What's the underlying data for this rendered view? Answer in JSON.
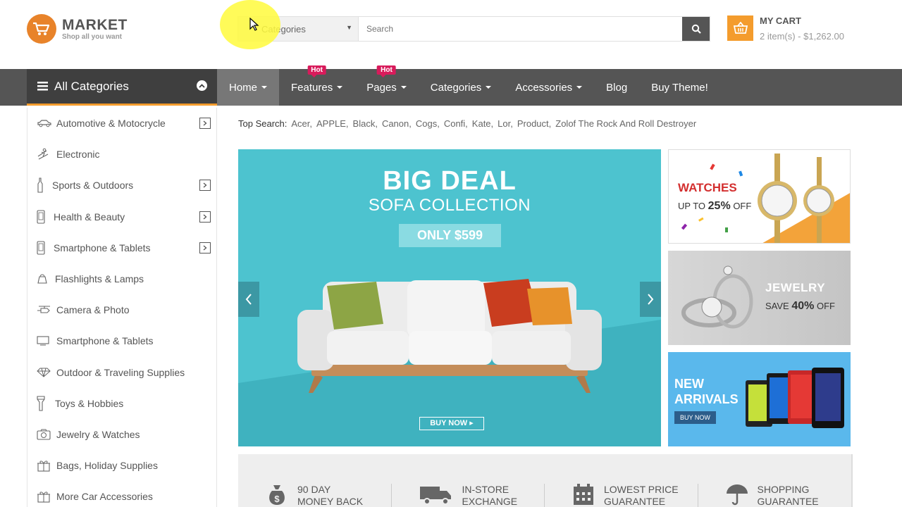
{
  "header": {
    "logo_title": "MARKET",
    "logo_tagline": "Shop all you want",
    "search_category": "All Categories",
    "search_category_visible": "Categories",
    "search_placeholder": "Search",
    "cart_title": "MY CART",
    "cart_summary": "2 item(s) - $1,262.00"
  },
  "nav": {
    "all_categories": "All Categories",
    "items": [
      {
        "label": "Home",
        "dropdown": true,
        "active": true
      },
      {
        "label": "Features",
        "dropdown": true,
        "badge": "Hot"
      },
      {
        "label": "Pages",
        "dropdown": true,
        "badge": "Hot"
      },
      {
        "label": "Categories",
        "dropdown": true
      },
      {
        "label": "Accessories",
        "dropdown": true
      },
      {
        "label": "Blog"
      },
      {
        "label": "Buy Theme!"
      }
    ]
  },
  "sidebar": {
    "items": [
      {
        "label": "Automotive & Motocrycle",
        "icon": "car-icon",
        "has_sub": true
      },
      {
        "label": "Electronic",
        "icon": "skier-icon",
        "has_sub": false
      },
      {
        "label": "Sports & Outdoors",
        "icon": "bottle-icon",
        "has_sub": true
      },
      {
        "label": "Health & Beauty",
        "icon": "phone-icon",
        "has_sub": true
      },
      {
        "label": "Smartphone & Tablets",
        "icon": "phone-icon",
        "has_sub": true
      },
      {
        "label": "Flashlights & Lamps",
        "icon": "bag-icon",
        "has_sub": false
      },
      {
        "label": "Camera & Photo",
        "icon": "helicopter-icon",
        "has_sub": false
      },
      {
        "label": "Smartphone & Tablets",
        "icon": "monitor-icon",
        "has_sub": false
      },
      {
        "label": "Outdoor & Traveling Supplies",
        "icon": "diamond-icon",
        "has_sub": false
      },
      {
        "label": "Toys & Hobbies",
        "icon": "flashlight-icon",
        "has_sub": false
      },
      {
        "label": "Jewelry & Watches",
        "icon": "camera-icon",
        "has_sub": false
      },
      {
        "label": "Bags, Holiday Supplies",
        "icon": "gift-icon",
        "has_sub": false
      },
      {
        "label": "More Car Accessories",
        "icon": "gift-icon",
        "has_sub": false
      }
    ]
  },
  "top_search": {
    "label": "Top Search:",
    "keywords": [
      "Acer,",
      "APPLE,",
      "Black,",
      "Canon,",
      "Cogs,",
      "Confi,",
      "Kate,",
      "Lor,",
      "Product,",
      "Zolof The Rock And Roll Destroyer"
    ]
  },
  "main_banner": {
    "headline": "BIG DEAL",
    "subheadline": "SOFA COLLECTION",
    "price_tag": "ONLY $599",
    "cta": "BUY NOW"
  },
  "side_banners": {
    "watches": {
      "title": "WATCHES",
      "prefix": "UP TO",
      "discount": "25%",
      "suffix": "OFF"
    },
    "jewelry": {
      "title": "JEWELRY",
      "prefix": "SAVE",
      "discount": "40%",
      "suffix": "OFF"
    },
    "arrivals": {
      "title_line1": "NEW",
      "title_line2": "ARRIVALS",
      "cta": "BUY NOW"
    }
  },
  "policies": [
    {
      "line1": "90 DAY",
      "line2": "MONEY BACK",
      "icon": "money-bag-icon"
    },
    {
      "line1": "IN-STORE",
      "line2": "EXCHANGE",
      "icon": "truck-icon"
    },
    {
      "line1": "LOWEST PRICE",
      "line2": "GUARANTEE",
      "icon": "calendar-icon"
    },
    {
      "line1": "SHOPPING",
      "line2": "GUARANTEE",
      "icon": "umbrella-icon"
    }
  ],
  "colors": {
    "accent": "#f49c2d",
    "nav_bg": "#555555",
    "banner_teal": "#4dc3cf",
    "hot_badge": "#d81b5b"
  }
}
